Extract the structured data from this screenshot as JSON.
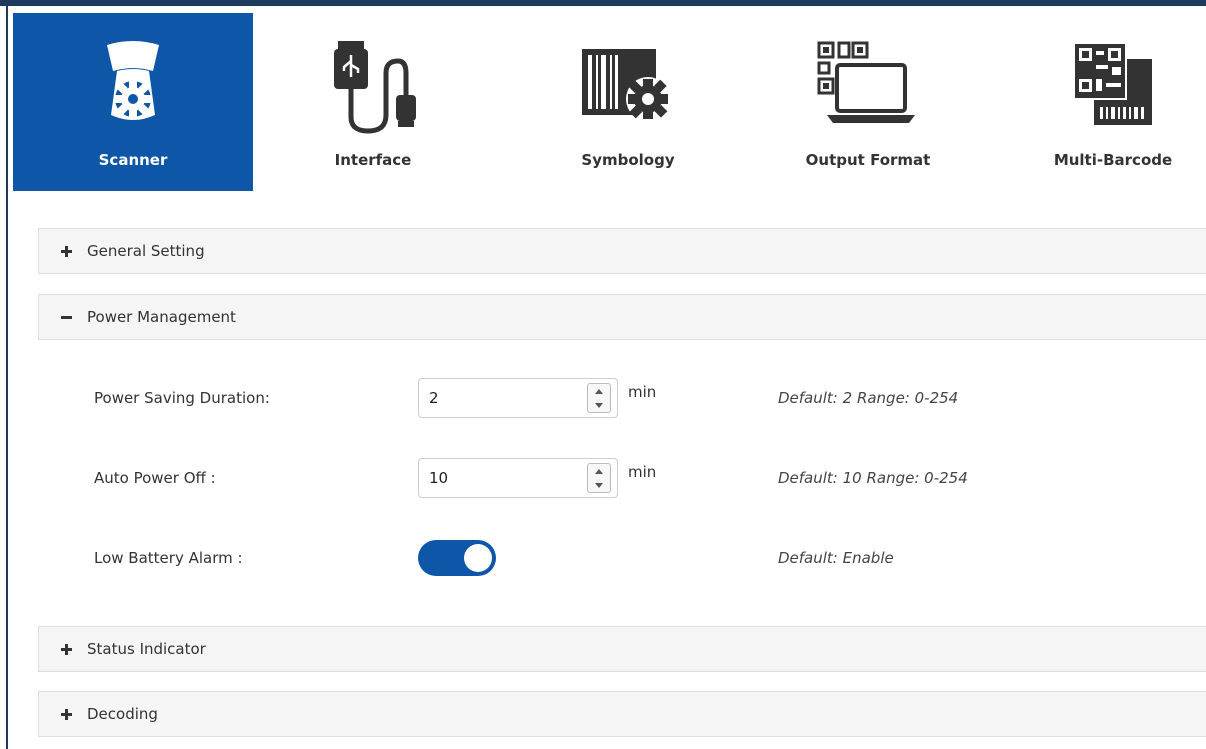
{
  "tabs": [
    {
      "label": "Scanner",
      "icon": "scanner-gear-icon",
      "active": true
    },
    {
      "label": "Interface",
      "icon": "usb-cable-icon",
      "active": false
    },
    {
      "label": "Symbology",
      "icon": "barcode-gear-icon",
      "active": false
    },
    {
      "label": "Output Format",
      "icon": "laptop-qr-icon",
      "active": false
    },
    {
      "label": "Multi-Barcode",
      "icon": "multi-barcode-icon",
      "active": false
    }
  ],
  "panels": {
    "general": {
      "title": "General Setting",
      "expanded": false
    },
    "power": {
      "title": "Power Management",
      "expanded": true
    },
    "status": {
      "title": "Status Indicator",
      "expanded": false
    },
    "decoding": {
      "title": "Decoding",
      "expanded": false
    }
  },
  "power_management": {
    "saving_duration": {
      "label": "Power Saving Duration:",
      "value": "2",
      "unit": "min",
      "hint": "Default: 2 Range: 0-254"
    },
    "auto_off": {
      "label": "Auto Power Off :",
      "value": "10",
      "unit": "min",
      "hint": "Default: 10 Range: 0-254"
    },
    "low_battery": {
      "label": "Low Battery Alarm :",
      "enabled": true,
      "hint": "Default: Enable"
    }
  },
  "colors": {
    "accent": "#0e56a8",
    "frame": "#1f3a5c",
    "panel_bg": "#f5f5f5"
  }
}
